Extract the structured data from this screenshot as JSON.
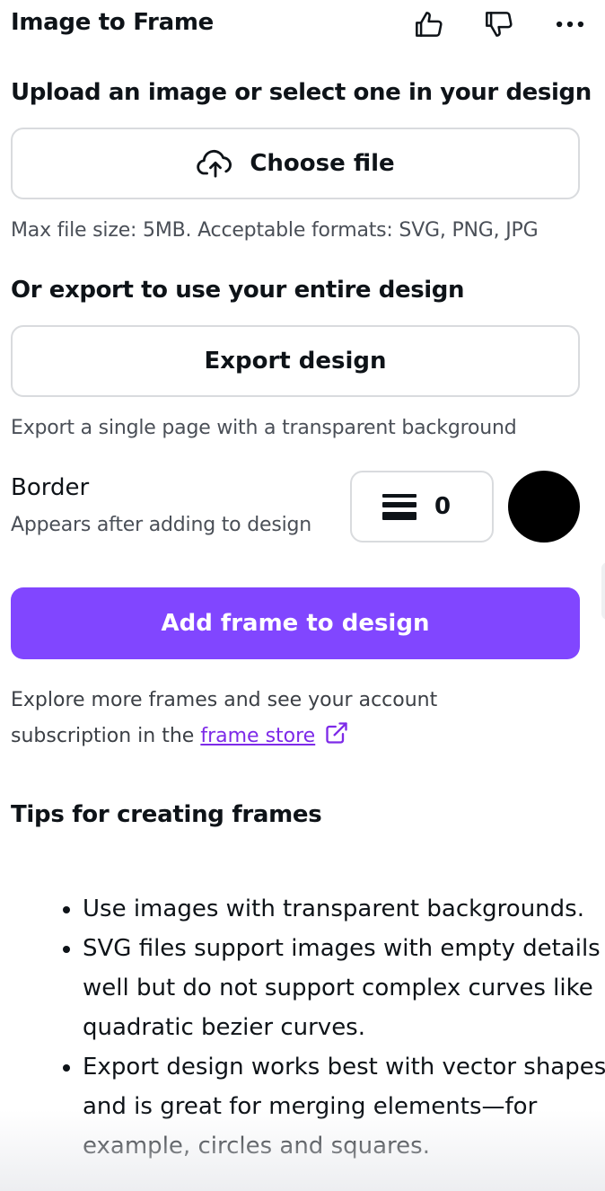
{
  "header": {
    "title": "Image to Frame",
    "icons": [
      "thumbs-up-icon",
      "thumbs-down-icon",
      "more-icon"
    ]
  },
  "upload": {
    "heading": "Upload an image or select one in your design",
    "button_label": "Choose file",
    "button_icon": "cloud-upload-icon",
    "help": "Max file size: 5MB. Acceptable formats: SVG, PNG, JPG"
  },
  "export": {
    "heading": "Or export to use your entire design",
    "button_label": "Export design",
    "help": "Export a single page with a transparent background"
  },
  "border": {
    "label": "Border",
    "sublabel": "Appears after adding to design",
    "value": "0",
    "stepper_icon": "border-weight-icon",
    "color": "#000000"
  },
  "primary": {
    "label": "Add frame to design",
    "color": "#8146ff"
  },
  "explore": {
    "line1": "Explore more frames and see your account",
    "line2_prefix": "subscription in the ",
    "link_text": "frame store",
    "link_color": "#7d2ae8",
    "link_icon": "external-link-icon"
  },
  "tips": {
    "heading": "Tips for creating frames",
    "items": [
      "Use images with transparent backgrounds.",
      "SVG files support images with empty details well but do not support complex curves like quadratic bezier curves.",
      "Export design works best with vector shapes and is great for merging elements—for example, circles and squares."
    ]
  }
}
